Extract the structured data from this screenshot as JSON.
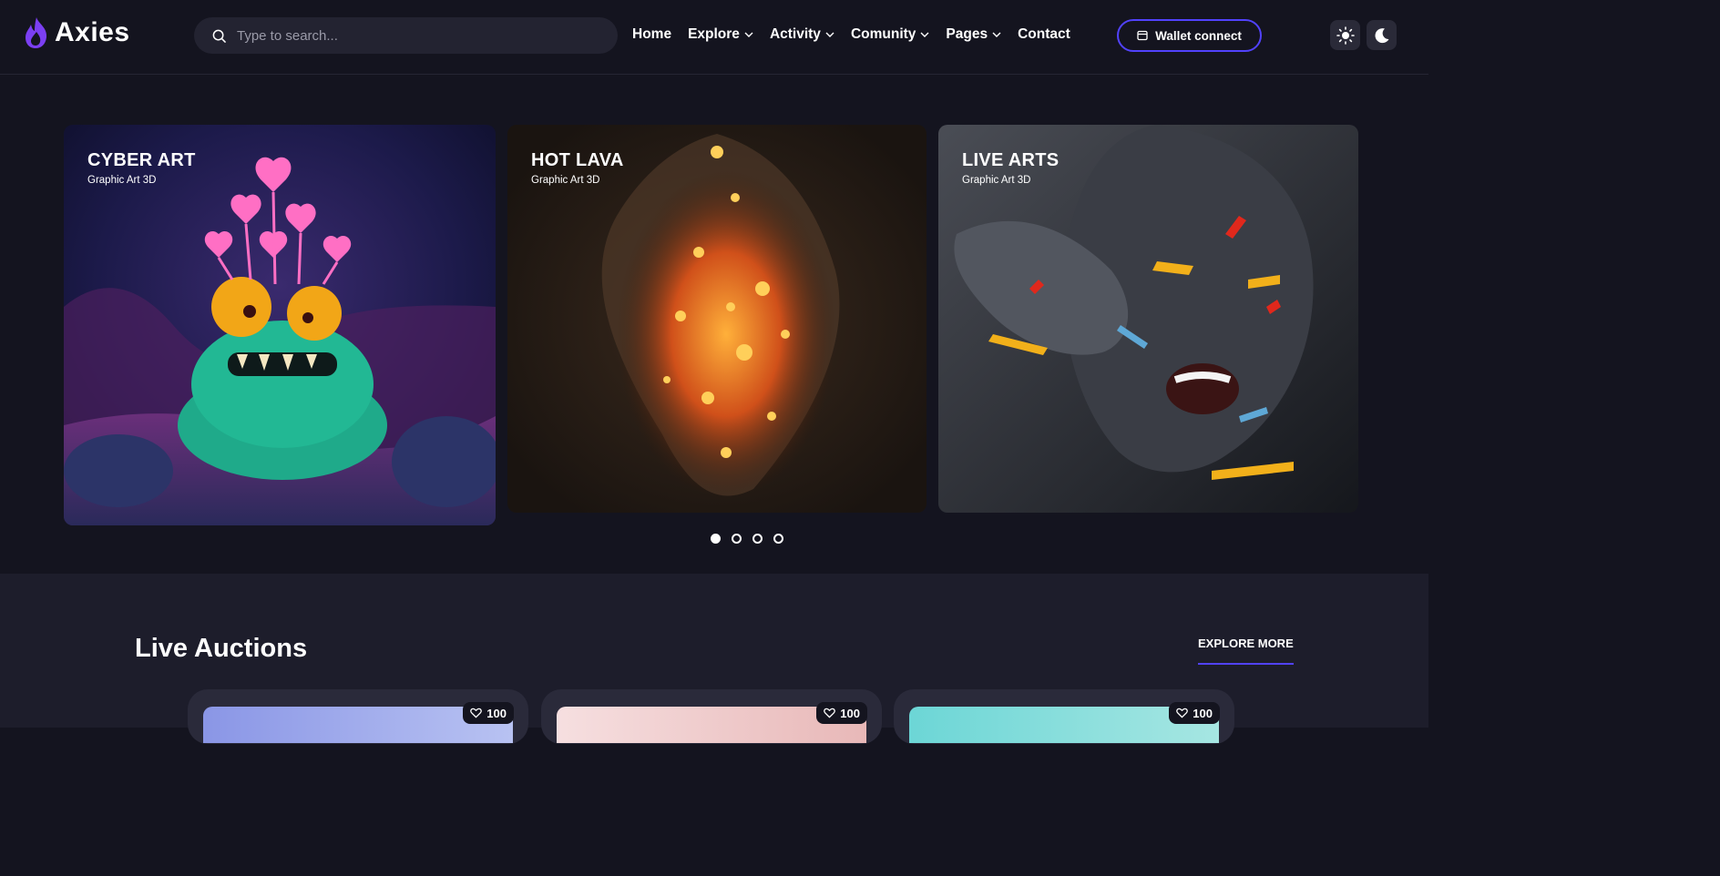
{
  "brand": {
    "name": "Axies",
    "accent": "#5142fc"
  },
  "search": {
    "placeholder": "Type to search..."
  },
  "nav": [
    {
      "label": "Home",
      "dropdown": false
    },
    {
      "label": "Explore",
      "dropdown": true
    },
    {
      "label": "Activity",
      "dropdown": true
    },
    {
      "label": "Comunity",
      "dropdown": true
    },
    {
      "label": "Pages",
      "dropdown": true
    },
    {
      "label": "Contact",
      "dropdown": false
    }
  ],
  "wallet": {
    "label": "Wallet connect",
    "icon": "wallet-icon"
  },
  "theme_toggle": {
    "light_icon": "sun-icon",
    "dark_icon": "moon-icon"
  },
  "slides": [
    {
      "title": "CYBER ART",
      "subtitle": "Graphic Art 3D"
    },
    {
      "title": "HOT LAVA",
      "subtitle": "Graphic Art 3D"
    },
    {
      "title": "LIVE ARTS",
      "subtitle": "Graphic Art 3D"
    }
  ],
  "carousel": {
    "total": 4,
    "active": 1
  },
  "live_auctions": {
    "title": "Live Auctions",
    "explore_label": "EXPLORE MORE",
    "items": [
      {
        "likes": "100"
      },
      {
        "likes": "100"
      },
      {
        "likes": "100"
      }
    ]
  }
}
